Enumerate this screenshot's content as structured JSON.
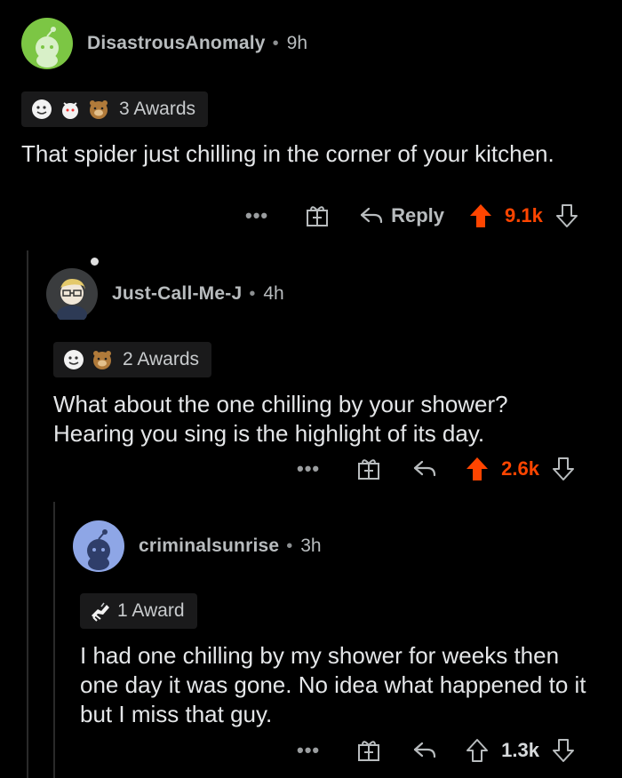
{
  "comments": [
    {
      "username": "DisastrousAnomaly",
      "time": "9h",
      "awards_label": "3 Awards",
      "body": "That spider just chilling in the corner of your kitchen.",
      "reply_label": "Reply",
      "score": "9.1k",
      "upvoted": true,
      "avatar_color": "#7cc644"
    },
    {
      "username": "Just-Call-Me-J",
      "time": "4h",
      "awards_label": "2 Awards",
      "body": "What about the one chilling by your shower? Hearing you sing is the highlight of its day.",
      "score": "2.6k",
      "upvoted": true,
      "avatar_color": "#3a3c3e"
    },
    {
      "username": "criminalsunrise",
      "time": "3h",
      "awards_label": "1 Award",
      "body": "I had one chilling by my shower for weeks then one day it was gone. No idea what happened to it but I miss that guy.",
      "score": "1.3k",
      "upvoted": false,
      "avatar_color": "#8ea6e6"
    }
  ],
  "more_label": "•••",
  "colors": {
    "upvote": "#ff4500",
    "background": "#000000",
    "award_bg": "#1a1a1b"
  }
}
